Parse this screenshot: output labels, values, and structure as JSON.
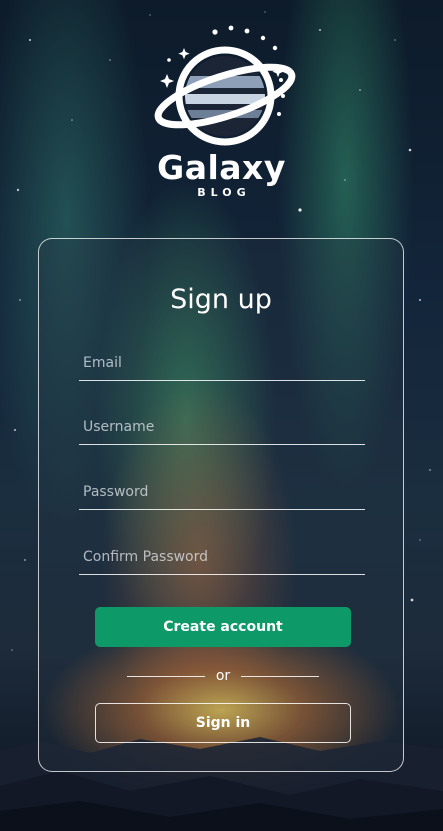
{
  "brand": {
    "name": "Galaxy",
    "subtitle": "BLOG",
    "logo_icon": "planet-ring-icon"
  },
  "form": {
    "title": "Sign up",
    "fields": {
      "email": {
        "value": "",
        "placeholder": "Email"
      },
      "username": {
        "value": "",
        "placeholder": "Username"
      },
      "password": {
        "value": "",
        "placeholder": "Password"
      },
      "confirm_password": {
        "value": "",
        "placeholder": "Confirm Password"
      }
    },
    "create_account_label": "Create account",
    "divider_text": "or",
    "sign_in_label": "Sign in"
  },
  "colors": {
    "primary_button": "#0e9968",
    "text": "#ffffff",
    "background_dark": "#0d1b2a"
  }
}
